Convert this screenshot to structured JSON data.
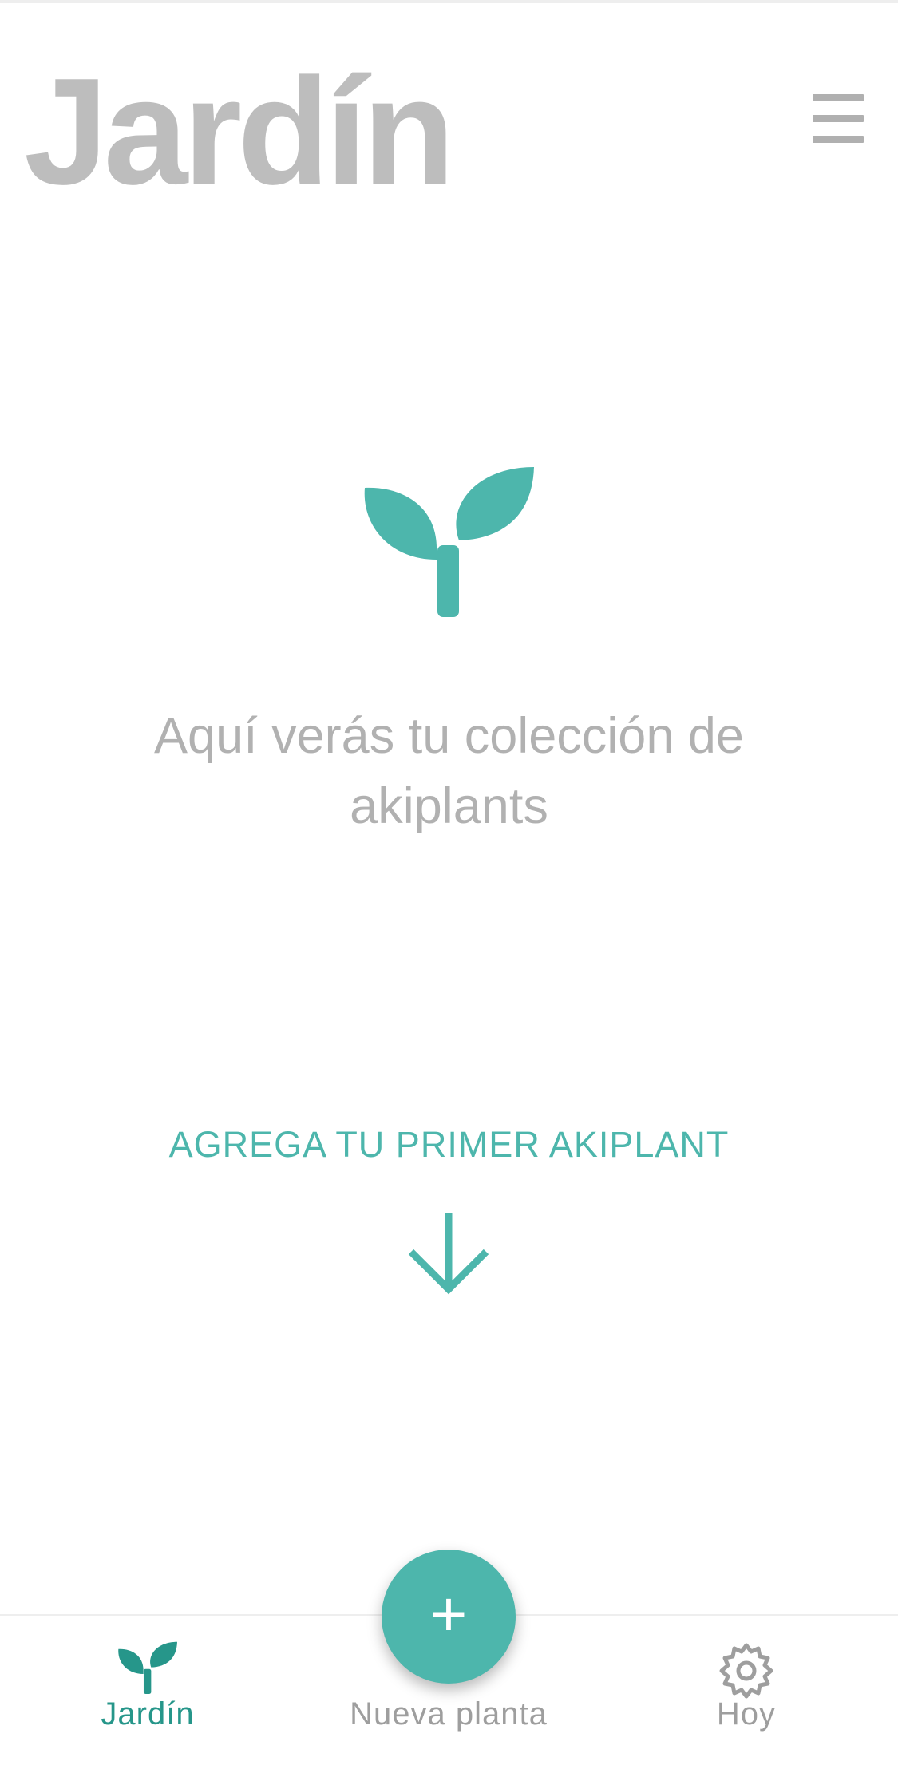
{
  "header": {
    "title": "Jardín",
    "menu_icon": "hamburger-menu-icon"
  },
  "empty_state": {
    "icon": "sprout-icon",
    "message": "Aquí verás tu colección de akiplants"
  },
  "cta": {
    "text": "AGREGA TU PRIMER AKIPLANT",
    "icon": "arrow-down-icon"
  },
  "fab": {
    "label": "+",
    "icon": "plus-icon"
  },
  "tab_bar": {
    "tabs": [
      {
        "label": "Jardín",
        "icon": "sprout-icon",
        "active": true
      },
      {
        "label": "Nueva planta",
        "icon": "",
        "active": false
      },
      {
        "label": "Hoy",
        "icon": "gear-icon",
        "active": false
      }
    ]
  },
  "colors": {
    "accent": "#4db6ac",
    "accent_dark": "#26968a",
    "title_gray": "#bdbdbd",
    "text_gray": "#b1b1b1",
    "tab_inactive": "#9e9e9e"
  }
}
